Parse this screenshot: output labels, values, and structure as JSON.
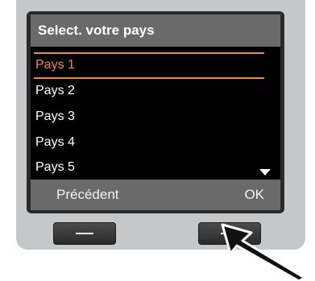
{
  "screen": {
    "title": "Select. votre pays",
    "list_items": [
      {
        "label": "Pays 1",
        "selected": true
      },
      {
        "label": "Pays 2",
        "selected": false
      },
      {
        "label": "Pays 3",
        "selected": false
      },
      {
        "label": "Pays 4",
        "selected": false
      },
      {
        "label": "Pays 5",
        "selected": false
      }
    ],
    "softkeys": {
      "left_label": "Précédent",
      "right_label": "OK"
    }
  },
  "colors": {
    "highlight": "#f08a2a",
    "bar_gray": "#6a6a6a",
    "housing": "#c5c7c9"
  }
}
